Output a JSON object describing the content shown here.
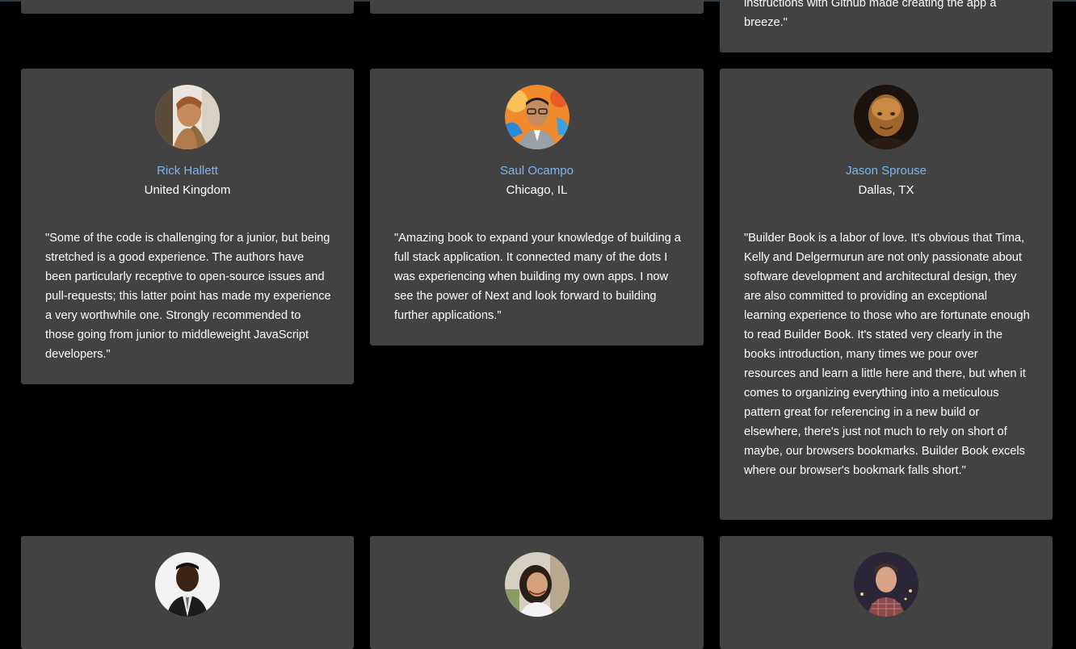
{
  "colors": {
    "background": "#000000",
    "card": "#424242",
    "name": "#7db6ec",
    "text": "#ffffff"
  },
  "top_row": {
    "card3_quote_tail": "instructions with Github made creating the app a breeze.\""
  },
  "testimonials": [
    {
      "name": "Rick Hallett",
      "location": "United Kingdom",
      "quote": "\"Some of the code is challenging for a junior, but being stretched is a good experience. The authors have been particularly receptive to open-source issues and pull-requests; this latter point has made my experience a very worthwhile one. Strongly recommended to those going from junior to middleweight JavaScript developers.\"",
      "avatar_icon": "person-photo"
    },
    {
      "name": "Saul Ocampo",
      "location": "Chicago, IL",
      "quote": "\"Amazing book to expand your knowledge of building a full stack application. It connected many of the dots I was experiencing when building my own apps. I now see the power of Next and look forward to building further applications.\"",
      "avatar_icon": "person-photo"
    },
    {
      "name": "Jason Sprouse",
      "location": "Dallas, TX",
      "quote": "\"Builder Book is a labor of love. It's obvious that Tima, Kelly and Delgermurun are not only passionate about software development and architectural design, they are also committed to providing an exceptional learning experience to those who are fortunate enough to read Builder Book. It's stated very clearly in the books introduction, many times we pour over resources and learn a little here and there, but when it comes to organizing everything into a meticulous pattern great for referencing in a new build or elsewhere, there's just not much to rely on short of maybe, our browsers bookmarks. Builder Book excels where our browser's bookmark falls short.\"",
      "avatar_icon": "person-photo"
    }
  ],
  "bottom_row": [
    {
      "avatar_icon": "person-photo"
    },
    {
      "avatar_icon": "person-photo"
    },
    {
      "avatar_icon": "person-photo"
    }
  ]
}
